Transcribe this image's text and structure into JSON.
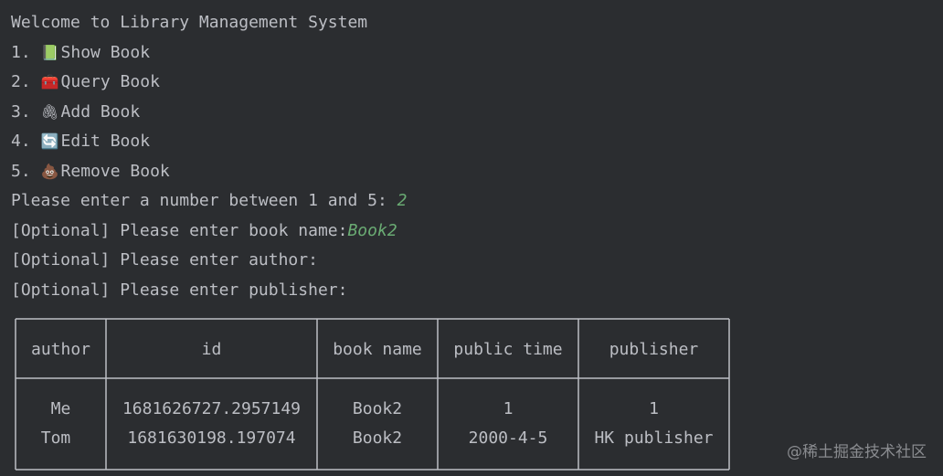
{
  "terminal": {
    "welcome": "Welcome to Library Management System",
    "menu": [
      {
        "number": "1.",
        "icon": "📗",
        "icon_name": "green-book-icon",
        "label": "Show Book"
      },
      {
        "number": "2.",
        "icon": "🧰",
        "icon_name": "toolbox-icon",
        "label": "Query Book"
      },
      {
        "number": "3.",
        "icon": "🖇",
        "icon_name": "paperclip-icon",
        "label": "Add Book"
      },
      {
        "number": "4.",
        "icon": "🔄",
        "icon_name": "refresh-icon",
        "label": "Edit Book"
      },
      {
        "number": "5.",
        "icon": "💩",
        "icon_name": "poop-icon",
        "label": "Remove Book"
      }
    ],
    "prompt_number": "Please enter a number between 1 and 5: ",
    "input_number": "2",
    "prompt_book_name": "[Optional] Please enter book name:",
    "input_book_name": "Book2",
    "prompt_author": "[Optional] Please enter author:",
    "prompt_publisher": "[Optional] Please enter publisher:"
  },
  "table": {
    "headers": [
      "author",
      "id",
      "book name",
      "public time",
      "publisher"
    ],
    "rows": [
      [
        "Me",
        "1681626727.2957149",
        "Book2",
        "1",
        "1"
      ],
      [
        "Tom",
        "1681630198.197074",
        "Book2",
        "2000-4-5",
        "HK publisher"
      ]
    ]
  },
  "watermark": "@稀土掘金技术社区",
  "colors": {
    "background": "#2b2d30",
    "text": "#bcbec4",
    "user_input": "#6aab73",
    "border": "#bcbec4"
  }
}
